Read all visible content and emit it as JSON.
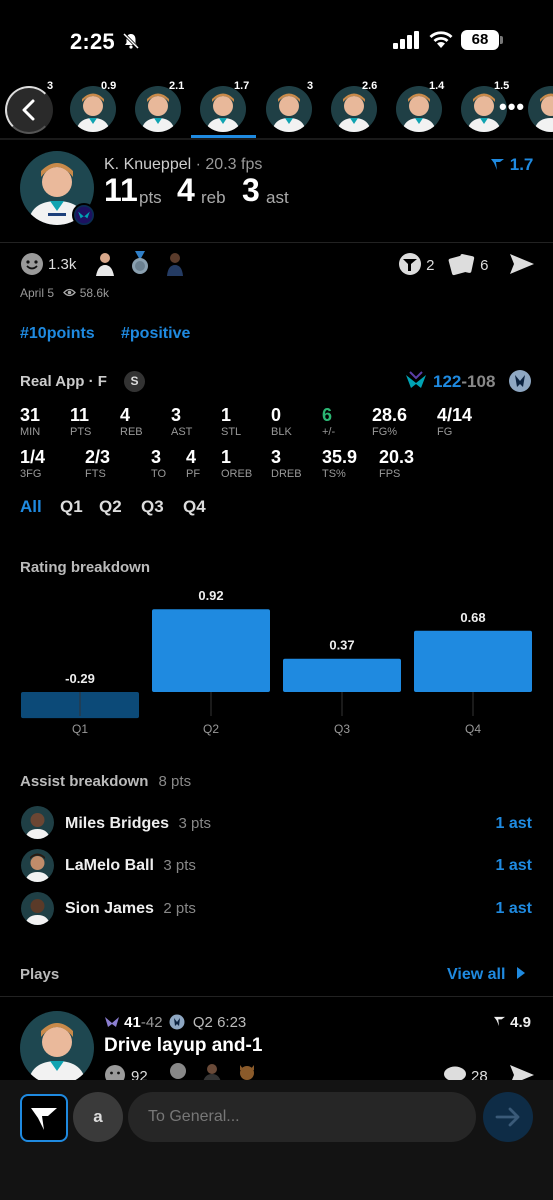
{
  "status_bar": {
    "time": "2:25",
    "battery": "68"
  },
  "strip": {
    "scores": [
      "3",
      "0.9",
      "2.1",
      "1.7",
      "3",
      "2.6",
      "1.4",
      "1.5"
    ],
    "more_icon": "more-horizontal-icon"
  },
  "player": {
    "name": "K. Knueppel",
    "separator": " · ",
    "fps": "20.3 fps",
    "pts": "11",
    "pts_label": "pts",
    "reb": "4",
    "reb_label": "reb",
    "ast": "3",
    "ast_label": "ast",
    "rating": "1.7"
  },
  "social": {
    "reactions": "1.3k",
    "shares": "2",
    "cards": "6",
    "date": "April 5",
    "views": "58.6k"
  },
  "hashtags": [
    "#10points",
    "#positive"
  ],
  "game": {
    "source": "Real App · F",
    "badge": "S",
    "score_team": "122",
    "score_sep": "-",
    "score_opp": "108"
  },
  "stats_row1": [
    {
      "value": "31",
      "label": "MIN"
    },
    {
      "value": "11",
      "label": "PTS"
    },
    {
      "value": "4",
      "label": "REB"
    },
    {
      "value": "3",
      "label": "AST"
    },
    {
      "value": "1",
      "label": "STL"
    },
    {
      "value": "0",
      "label": "BLK"
    },
    {
      "value": "6",
      "label": "+/-"
    },
    {
      "value": "28.6",
      "label": "FG%"
    },
    {
      "value": "4/14",
      "label": "FG"
    }
  ],
  "stats_row2": [
    {
      "value": "1/4",
      "label": "3FG"
    },
    {
      "value": "2/3",
      "label": "FTS"
    },
    {
      "value": "3",
      "label": "TO"
    },
    {
      "value": "4",
      "label": "PF"
    },
    {
      "value": "1",
      "label": "OREB"
    },
    {
      "value": "3",
      "label": "DREB"
    },
    {
      "value": "35.9",
      "label": "TS%"
    },
    {
      "value": "20.3",
      "label": "FPS"
    }
  ],
  "tabs": [
    "All",
    "Q1",
    "Q2",
    "Q3",
    "Q4"
  ],
  "rating_title": "Rating breakdown",
  "chart_data": {
    "type": "bar",
    "categories": [
      "Q1",
      "Q2",
      "Q3",
      "Q4"
    ],
    "values": [
      -0.29,
      0.92,
      0.37,
      0.68
    ],
    "value_labels": [
      "-0.29",
      "0.92",
      "0.37",
      "0.68"
    ],
    "title": "Rating breakdown",
    "colors": {
      "positive": "#1f8ae0",
      "negative": "#0c4a78"
    }
  },
  "assist": {
    "title": "Assist breakdown",
    "total": "8 pts",
    "items": [
      {
        "name": "Miles Bridges",
        "pts": "3 pts",
        "count": "1 ast"
      },
      {
        "name": "LaMelo Ball",
        "pts": "3 pts",
        "count": "1 ast"
      },
      {
        "name": "Sion James",
        "pts": "2 pts",
        "count": "1 ast"
      }
    ]
  },
  "plays": {
    "title": "Plays",
    "view_all": "View all",
    "item": {
      "score_team": "41",
      "score_sep": "-",
      "score_opp": "42",
      "time": "Q2 6:23",
      "title": "Drive layup and-1",
      "rating": "4.9",
      "reactions": "92",
      "comments": "28"
    }
  },
  "composer": {
    "avatar_letter": "a",
    "placeholder": "To General..."
  }
}
